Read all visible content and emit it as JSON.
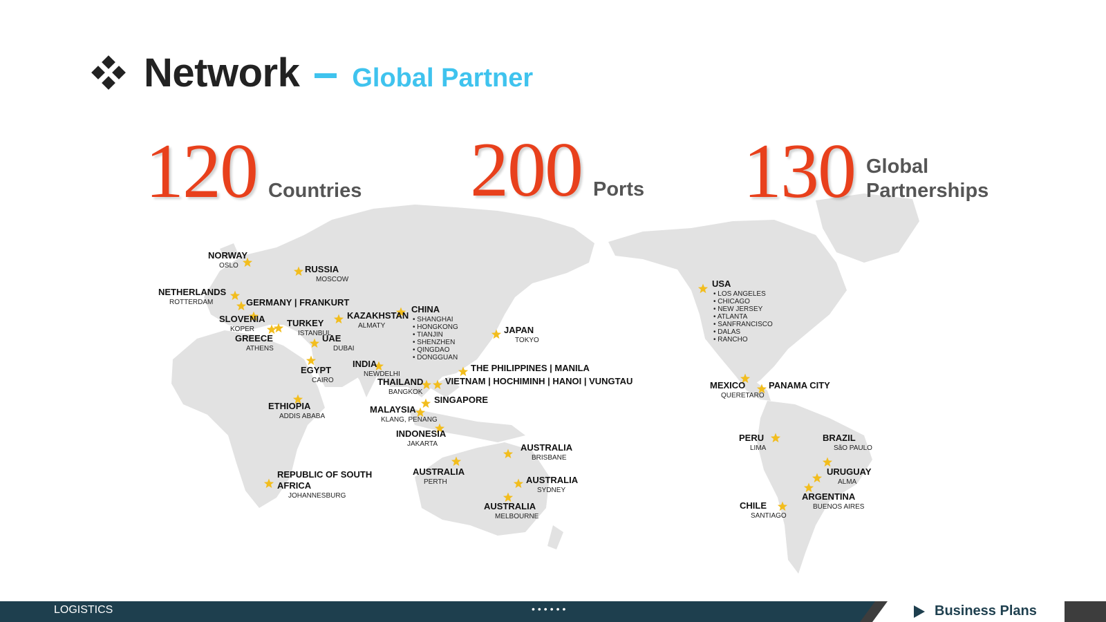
{
  "title": {
    "main": "Network",
    "sub": "Global Partner"
  },
  "stats": [
    {
      "value": "120",
      "label_lines": [
        "Countries"
      ]
    },
    {
      "value": "200",
      "label_lines": [
        "Ports"
      ]
    },
    {
      "value": "130",
      "label_lines": [
        "Global",
        "Partnerships"
      ]
    }
  ],
  "colors": {
    "accent": "#e8401c",
    "sub_title": "#3fc3ee",
    "star": "#f2bd1d",
    "land": "#e2e2e2",
    "footer": "#1e3f4e"
  },
  "locations": [
    {
      "name": "NORWAY",
      "sub": [
        "OSLO"
      ]
    },
    {
      "name": "RUSSIA",
      "sub": [
        "MOSCOW"
      ]
    },
    {
      "name": "NETHERLANDS",
      "sub": [
        "ROTTERDAM"
      ]
    },
    {
      "name": "GERMANY | FRANKURT",
      "sub": []
    },
    {
      "name": "SLOVENIA",
      "sub": [
        "KOPER"
      ]
    },
    {
      "name": "TURKEY",
      "sub": [
        "ISTANBUL"
      ]
    },
    {
      "name": "GREECE",
      "sub": [
        "ATHENS"
      ]
    },
    {
      "name": "KAZAKHSTAN",
      "sub": [
        "ALMATY"
      ]
    },
    {
      "name": "CHINA",
      "sub": [
        "• SHANGHAI",
        "• HONGKONG",
        "• TIANJIN",
        "• SHENZHEN",
        "• QINGDAO",
        "• DONGGUAN"
      ]
    },
    {
      "name": "UAE",
      "sub": [
        "DUBAI"
      ]
    },
    {
      "name": "JAPAN",
      "sub": [
        "TOKYO"
      ]
    },
    {
      "name": "EGYPT",
      "sub": [
        "CAIRO"
      ]
    },
    {
      "name": "INDIA",
      "sub": [
        "NEWDELHI"
      ]
    },
    {
      "name": "THE PHILIPPINES | MANILA",
      "sub": []
    },
    {
      "name": "THAILAND",
      "sub": [
        "BANGKOK"
      ]
    },
    {
      "name": "VIETNAM | HOCHIMINH | HANOI | VUNGTAU",
      "sub": []
    },
    {
      "name": "ETHIOPIA",
      "sub": [
        "ADDIS ABABA"
      ]
    },
    {
      "name": "SINGAPORE",
      "sub": []
    },
    {
      "name": "MALAYSIA",
      "sub": [
        "KLANG, PENANG"
      ]
    },
    {
      "name": "INDONESIA",
      "sub": [
        "JAKARTA"
      ]
    },
    {
      "name": "AUSTRALIA",
      "sub": [
        "BRISBANE"
      ]
    },
    {
      "name": "AUSTRALIA",
      "sub": [
        "PERTH"
      ]
    },
    {
      "name": "REPUBLIC OF SOUTH",
      "sub": []
    },
    {
      "name": "AFRICA",
      "sub": [
        "JOHANNESBURG"
      ]
    },
    {
      "name": "AUSTRALIA",
      "sub": [
        "SYDNEY"
      ]
    },
    {
      "name": "AUSTRALIA",
      "sub": [
        "MELBOURNE"
      ]
    },
    {
      "name": "USA",
      "sub": [
        "• LOS ANGELES",
        "• CHICAGO",
        "• NEW JERSEY",
        "• ATLANTA",
        "• SANFRANCISCO",
        "• DALAS",
        "• RANCHO"
      ]
    },
    {
      "name": "MEXICO",
      "sub": [
        "QUERETARO"
      ]
    },
    {
      "name": "PANAMA CITY",
      "sub": []
    },
    {
      "name": "PERU",
      "sub": [
        "LIMA"
      ]
    },
    {
      "name": "BRAZIL",
      "sub": [
        "SãO PAULO"
      ]
    },
    {
      "name": "URUGUAY",
      "sub": [
        "ALMA"
      ]
    },
    {
      "name": "ARGENTINA",
      "sub": [
        "BUENOS AIRES"
      ]
    },
    {
      "name": "CHILE",
      "sub": [
        "SANTIAGO"
      ]
    }
  ],
  "footer": {
    "left_label": "LOGISTICS",
    "dots": "••••••",
    "right_label": "Business Plans"
  }
}
